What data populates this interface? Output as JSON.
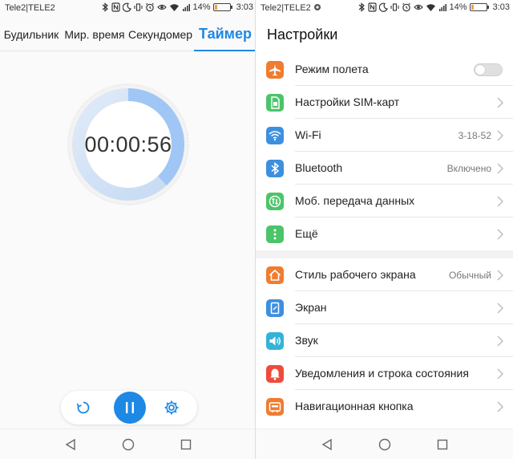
{
  "left": {
    "status": {
      "carrier": "Tele2|TELE2",
      "battery": "14%",
      "time": "3:03"
    },
    "tabs": [
      {
        "label": "Будильник"
      },
      {
        "label": "Мир. время"
      },
      {
        "label": "Секундомер"
      },
      {
        "label": "Таймер"
      }
    ],
    "timer": {
      "time": "00:00:56",
      "progress": 0.38
    },
    "accent": "#1e88e5"
  },
  "right": {
    "status": {
      "carrier": "Tele2|TELE2",
      "battery": "14%",
      "time": "3:03"
    },
    "title": "Настройки",
    "group1": [
      {
        "label": "Режим полета",
        "icon": "airplane-icon",
        "color": "#f07c30",
        "toggle": false
      },
      {
        "label": "Настройки SIM-карт",
        "icon": "sim-icon",
        "color": "#4cc46a"
      },
      {
        "label": "Wi-Fi",
        "icon": "wifi-icon",
        "color": "#3d8fe0",
        "value": "3-18-52"
      },
      {
        "label": "Bluetooth",
        "icon": "bluetooth-icon",
        "color": "#3d8fe0",
        "value": "Включено"
      },
      {
        "label": "Моб. передача данных",
        "icon": "mobile-data-icon",
        "color": "#4cc46a"
      },
      {
        "label": "Ещё",
        "icon": "more-icon",
        "color": "#4cc46a"
      }
    ],
    "group2": [
      {
        "label": "Стиль рабочего экрана",
        "icon": "home-style-icon",
        "color": "#f07c30",
        "value": "Обычный"
      },
      {
        "label": "Экран",
        "icon": "display-icon",
        "color": "#3d8fe0"
      },
      {
        "label": "Звук",
        "icon": "sound-icon",
        "color": "#34b3d9"
      },
      {
        "label": "Уведомления и строка состояния",
        "icon": "notification-icon",
        "color": "#ee4b3b"
      },
      {
        "label": "Навигационная кнопка",
        "icon": "nav-key-icon",
        "color": "#f07c30"
      }
    ]
  }
}
